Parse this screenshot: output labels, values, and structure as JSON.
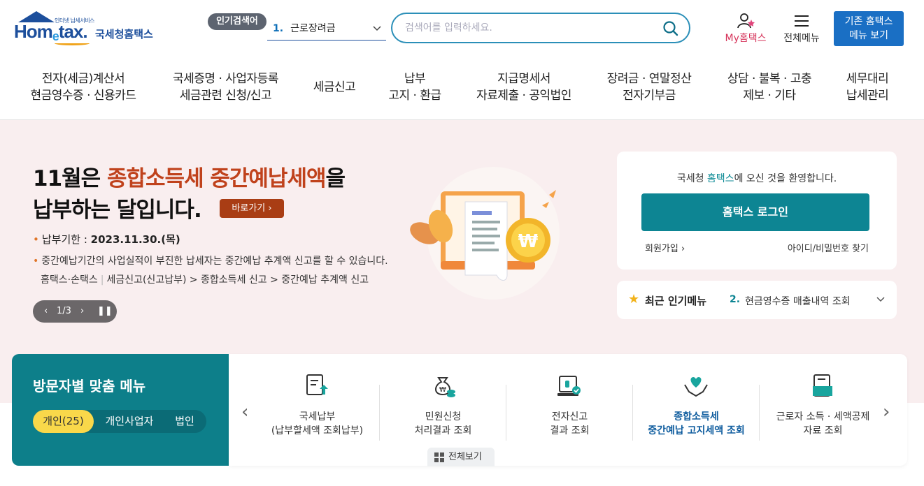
{
  "header": {
    "logo_small": "인터넷 납세서비스",
    "logo_text_a": "Hom",
    "logo_text_e": "e",
    "logo_text_b": "tax.",
    "logo_kr": "국세청홈택스",
    "popular_badge": "인기검색어",
    "popular_num": "1.",
    "popular_term": "근로장려금",
    "search_placeholder": "검색어를 입력하세요.",
    "my_hometax": "My홈택스",
    "all_menu": "전체메뉴",
    "old_menu_line1": "기존 홈택스",
    "old_menu_line2": "메뉴 보기"
  },
  "gnb": [
    {
      "line1": "전자(세금)계산서",
      "line2": "현금영수증 · 신용카드"
    },
    {
      "line1": "국세증명 · 사업자등록",
      "line2": "세금관련 신청/신고"
    },
    {
      "line1": "세금신고",
      "line2": ""
    },
    {
      "line1": "납부",
      "line2": "고지 · 환급"
    },
    {
      "line1": "지급명세서",
      "line2": "자료제출 · 공익법인"
    },
    {
      "line1": "장려금 · 연말정산",
      "line2": "전자기부금"
    },
    {
      "line1": "상담 · 불복 · 고충",
      "line2": "제보 · 기타"
    },
    {
      "line1": "세무대리",
      "line2": "납세관리"
    }
  ],
  "hero": {
    "title_pre": "11월은 ",
    "title_highlight": "종합소득세 중간예납세액",
    "title_post": "을",
    "title_line2": "납부하는 달입니다.",
    "go_button": "바로가기",
    "deadline_label": "납부기한 : ",
    "deadline_value": "2023.11.30.(목)",
    "description": "중간예납기간의 사업실적이 부진한 납세자는 중간예납 추계액 신고를 할 수 있습니다.",
    "path_site": "홈택스·손택스",
    "path": "세금신고(신고납부) > 종합소득세 신고 > 중간예납 추계액 신고",
    "pager": "1/3"
  },
  "login": {
    "welcome_pre": "국세청 ",
    "welcome_hl": "홈택스",
    "welcome_post": "에 오신 것을 환영합니다.",
    "login_button": "홈택스 로그인",
    "join": "회원가입",
    "find": "아이디/비밀번호 찾기"
  },
  "recent": {
    "title": "최근 인기메뉴",
    "num": "2.",
    "item": "현금영수증 매출내역 조회"
  },
  "visitor": {
    "title": "방문자별 맞춤 메뉴",
    "tabs": [
      "개인(25)",
      "개인사업자",
      "법인"
    ],
    "items": [
      {
        "line1": "국세납부",
        "line2": "(납부할세액 조회납부)"
      },
      {
        "line1": "민원신청",
        "line2": "처리결과 조회"
      },
      {
        "line1": "전자신고",
        "line2": "결과 조회"
      },
      {
        "line1": "종합소득세",
        "line2": "중간예납 고지세액 조회"
      },
      {
        "line1": "근로자 소득 · 세액공제",
        "line2": "자료 조회"
      }
    ],
    "view_all": "전체보기"
  },
  "colors": {
    "teal": "#0d8593",
    "brand_blue": "#1d4f9c",
    "hero_bg": "#f9eeef",
    "accent_red": "#c0421c"
  }
}
